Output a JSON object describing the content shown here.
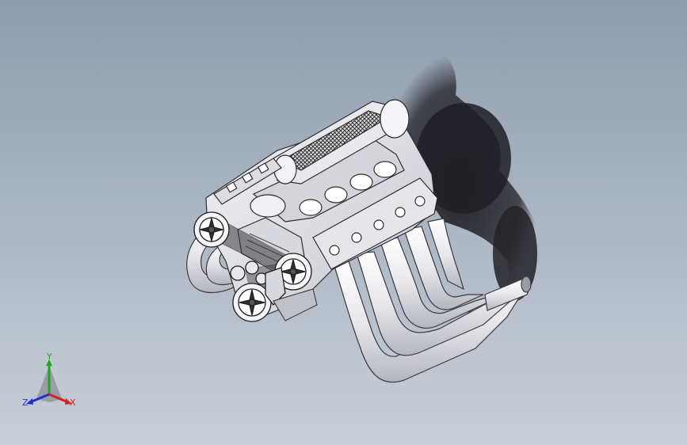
{
  "viewport": {
    "background_top": "#8e9cae",
    "background_bottom": "#c9cfd7",
    "model": "engine-assembly"
  },
  "triad": {
    "x_label": "X",
    "y_label": "Y",
    "z_label": "Z",
    "x_color": "#d42020",
    "y_color": "#1fa81f",
    "z_color": "#2030d0"
  }
}
